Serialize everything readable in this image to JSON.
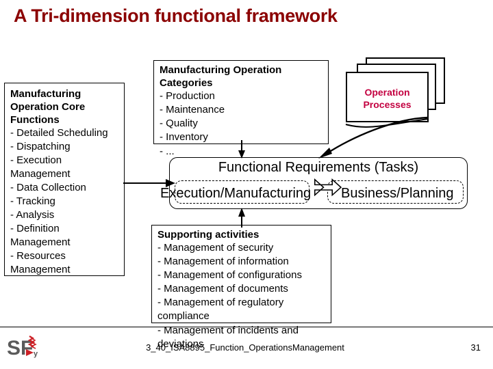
{
  "slide": {
    "title": "A Tri-dimension functional framework",
    "title_color": "#8B0000"
  },
  "core_functions_box": {
    "title_lines": [
      "Manufacturing",
      "Operation Core",
      "Functions"
    ],
    "items": [
      "- Detailed Scheduling",
      "- Dispatching",
      "- Execution",
      "Management",
      "- Data Collection",
      "- Tracking",
      "- Analysis",
      "- Definition",
      "Management",
      "- Resources",
      "Management"
    ]
  },
  "categories_box": {
    "title_lines": [
      "Manufacturing Operation",
      "Categories"
    ],
    "items": [
      "- Production",
      "- Maintenance",
      "- Quality",
      "- Inventory"
    ],
    "overflow_item": "- ..."
  },
  "operation_processes": {
    "label_lines": [
      "Operation",
      "Processes"
    ],
    "label_color": "#C30040"
  },
  "functional_requirements": {
    "title": "Functional Requirements (Tasks)",
    "left_label": "Execution/Manufacturing",
    "right_label": "Business/Planning",
    "arrow_icon": "double-headed-arrow"
  },
  "supporting_box": {
    "title": "Supporting activities",
    "items": [
      "- Management of security",
      "- Management of information",
      "- Management of configurations",
      "- Management of documents",
      "- Management of regulatory",
      "compliance"
    ],
    "overflow_items": [
      "- Management of incidents and",
      "deviations"
    ]
  },
  "footer": {
    "text": "3_40_ISA8895_Function_OperationsManagement",
    "page_number": "31",
    "logo_text": "SF",
    "logo_sub": "y",
    "logo_gray": "#5A5A5A",
    "logo_red": "#CC2026"
  }
}
